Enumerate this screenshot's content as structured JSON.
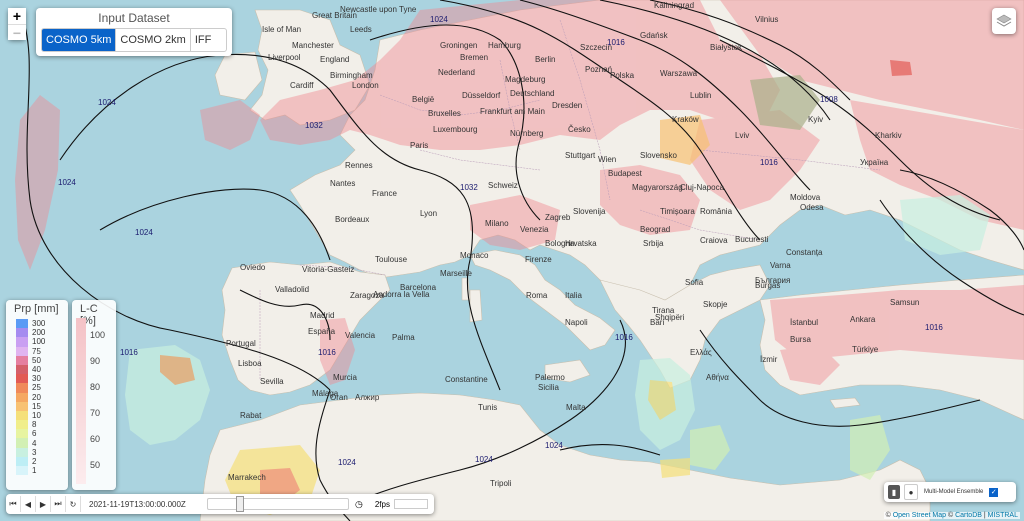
{
  "zoom": {
    "in": "+",
    "out": "−"
  },
  "dataset": {
    "title": "Input Dataset",
    "options": [
      {
        "label": "COSMO 5km",
        "active": true
      },
      {
        "label": "COSMO 2km",
        "active": false
      },
      {
        "label": "IFF",
        "active": false
      }
    ]
  },
  "legend_precip": {
    "title": "Prp [mm]",
    "items": [
      {
        "label": "300",
        "color": "#5a9bf5"
      },
      {
        "label": "200",
        "color": "#a58cf0"
      },
      {
        "label": "100",
        "color": "#c9a0f2"
      },
      {
        "label": "75",
        "color": "#e0b4f0"
      },
      {
        "label": "50",
        "color": "#e57fa0"
      },
      {
        "label": "40",
        "color": "#d4606a"
      },
      {
        "label": "30",
        "color": "#e25b55"
      },
      {
        "label": "25",
        "color": "#f08a5a"
      },
      {
        "label": "20",
        "color": "#f5a862"
      },
      {
        "label": "15",
        "color": "#f8c273"
      },
      {
        "label": "10",
        "color": "#f5e07a"
      },
      {
        "label": "8",
        "color": "#f0ee8a"
      },
      {
        "label": "6",
        "color": "#e7f4a0"
      },
      {
        "label": "4",
        "color": "#d2f0b4"
      },
      {
        "label": "3",
        "color": "#c8f0e0"
      },
      {
        "label": "2",
        "color": "#bdeef5"
      },
      {
        "label": "1",
        "color": "#d8f4fa"
      }
    ]
  },
  "legend_lc": {
    "title": "L-C [%]",
    "labels": [
      "100",
      "90",
      "80",
      "70",
      "60",
      "50"
    ]
  },
  "timebar": {
    "buttons": [
      "⏮",
      "◀",
      "▶",
      "⏭",
      "↻"
    ],
    "timestamp": "2021-11-19T13:00:00.000Z",
    "fps": "2fps"
  },
  "ensemble": {
    "label": "Multi-Model Ensemble",
    "checked": true
  },
  "attribution": {
    "sep1": "©",
    "osm": "Open Street Map",
    "sep2": "©",
    "carto": "CartoDB",
    "sep3": "|",
    "mistral": "MISTRAL"
  },
  "map_labels": {
    "cities": [
      "Isle of Man",
      "Great Britain",
      "Newcastle upon Tyne",
      "Leeds",
      "Manchester",
      "Liverpool",
      "England",
      "Cardiff",
      "Birmingham",
      "London",
      "Groningen",
      "Hamburg",
      "Szczecin",
      "Gdańsk",
      "Kaliningrad",
      "Vilnius",
      "Bremen",
      "Nederland",
      "Berlin",
      "Poznań",
      "Białystok",
      "Magdeburg",
      "Deutschland",
      "Polska",
      "Warszawa",
      "Lublin",
      "Dresden",
      "België",
      "Bruxelles",
      "Düsseldorf",
      "Frankfurt am Main",
      "Luxembourg",
      "Paris",
      "Nürnberg",
      "Česko",
      "Kraków",
      "Stuttgart",
      "Wien",
      "Slovensko",
      "Rennes",
      "Nantes",
      "France",
      "Bordeaux",
      "Lyon",
      "Schweiz",
      "Milano",
      "Venezia",
      "Slovenija",
      "Zagreb",
      "Hrvatska",
      "Magyarország",
      "Budapest",
      "România",
      "Timișoara",
      "Cluj-Napoca",
      "Beograd",
      "Srbija",
      "Bucuresti",
      "Craiova",
      "Constanța",
      "Bologna",
      "Firenze",
      "Monaco",
      "Marseille",
      "Toulouse",
      "Andorra la Vella",
      "Oviedo",
      "Vitoria-Gasteiz",
      "Valladolid",
      "Zaragoza",
      "Barcelona",
      "Madrid",
      "Portugal",
      "Lisboa",
      "Valencia",
      "España",
      "Palma",
      "Sevilla",
      "Murcia",
      "Málaga",
      "Roma",
      "Italia",
      "Napoli",
      "Bari",
      "Palermo",
      "Sicilia",
      "Malta",
      "Tirana",
      "Shqipëri",
      "Sofia",
      "България",
      "Varna",
      "Burgas",
      "Skopje",
      "Ελλάς",
      "Αθήνα",
      "İzmir",
      "Bursa",
      "İstanbul",
      "Ankara",
      "Türkiye",
      "Samsun",
      "Kyiv",
      "Lviv",
      "Moldova",
      "Odesa",
      "Україна",
      "Kharkiv",
      "Алжир",
      "Oran",
      "Constantine",
      "Tunis",
      "Rabat",
      "Marrakech",
      "Tripoli"
    ],
    "isobars": [
      "1024",
      "1032",
      "1024",
      "1024",
      "1016",
      "1008",
      "1016",
      "1024",
      "1016",
      "1016",
      "1024",
      "1032",
      "1024",
      "1016",
      "1024",
      "1016"
    ]
  }
}
